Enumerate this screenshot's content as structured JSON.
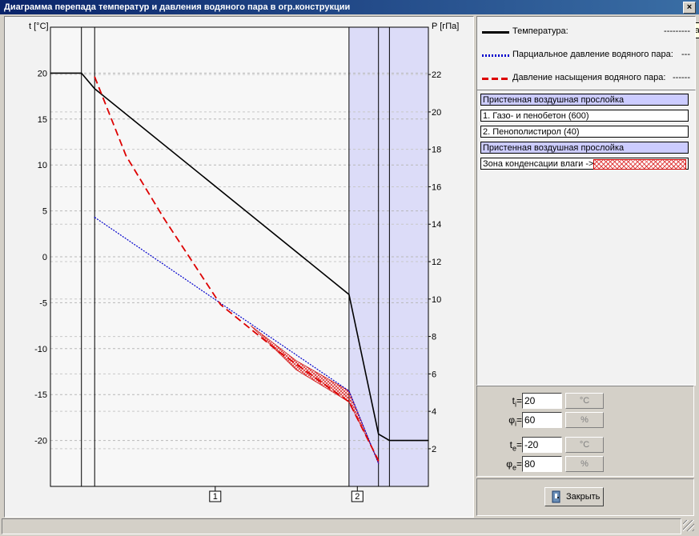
{
  "window": {
    "title": "Диаграмма перепада температур и давления водяного пара в огр.конструкции",
    "close_glyph": "×",
    "tooltip": "Закрыть"
  },
  "legend": [
    {
      "label": "Температура:",
      "dash": "---------",
      "color": "#000000",
      "style": "solid"
    },
    {
      "label": "Парциальное давление водяного пара:",
      "dash": "---",
      "color": "#0000cc",
      "style": "dotted"
    },
    {
      "label": "Давление насыщения водяного пара:",
      "dash": "------",
      "color": "#dd0000",
      "style": "dashed"
    }
  ],
  "layers": [
    {
      "label": "Пристенная воздушная прослойка",
      "kind": "air"
    },
    {
      "label": "1. Газо- и пенобетон (600)",
      "kind": "mat"
    },
    {
      "label": "2. Пенополистирол (40)",
      "kind": "mat"
    },
    {
      "label": "Пристенная воздушная прослойка",
      "kind": "air"
    },
    {
      "label": "Зона конденсации влаги ->",
      "kind": "cond"
    }
  ],
  "params": [
    {
      "sym": "t",
      "sub": "i",
      "value": "20",
      "unit": "°C"
    },
    {
      "sym": "φ",
      "sub": "i",
      "value": "60",
      "unit": "%"
    },
    {
      "sym": "t",
      "sub": "e",
      "value": "-20",
      "unit": "°C"
    },
    {
      "sym": "φ",
      "sub": "e",
      "value": "80",
      "unit": "%"
    }
  ],
  "close_button": "Закрыть",
  "chart_data": {
    "type": "line",
    "left_axis_label": "t [°C]",
    "right_axis_label": "P [гПа]",
    "left_ylim": [
      -25,
      25
    ],
    "left_ticks": [
      20,
      15,
      10,
      5,
      0,
      -5,
      -10,
      -15,
      -20
    ],
    "right_ticks": [
      22,
      20,
      18,
      16,
      14,
      12,
      10,
      8,
      6,
      4,
      2
    ],
    "x_markers": [
      "1",
      "2"
    ],
    "series": [
      {
        "color": "#000000",
        "style": "solid",
        "x": [
          0,
          0.082,
          0.117,
          0.79,
          0.868,
          0.897,
          1.0
        ],
        "values": [
          20,
          20,
          18.3,
          -4.1,
          -19.3,
          -20,
          -20
        ]
      },
      {
        "color": "#0000cc",
        "style": "dotted",
        "x": [
          0.117,
          0.79,
          0.868
        ],
        "values": [
          4.3,
          -14.6,
          -22.5
        ]
      },
      {
        "color": "#dd0000",
        "style": "dashed",
        "x": [
          0.117,
          0.2,
          0.3,
          0.45,
          0.6,
          0.79,
          0.868
        ],
        "values": [
          19.6,
          11.0,
          4.2,
          -5.2,
          -10.2,
          -15.8,
          -22.2
        ]
      }
    ],
    "condensation_band": {
      "x": [
        0.53,
        0.65,
        0.79,
        0.868
      ],
      "upper": [
        -7.5,
        -11.3,
        -14.6,
        -22.5
      ],
      "lower": [
        -7.5,
        -12.3,
        -15.8,
        -22.2
      ]
    },
    "layer_bounds": [
      0,
      0.082,
      0.117,
      0.79,
      0.868,
      0.897,
      1.0
    ],
    "layer_kinds": [
      "air",
      "mat",
      "mat",
      "air",
      "air",
      "air"
    ]
  }
}
